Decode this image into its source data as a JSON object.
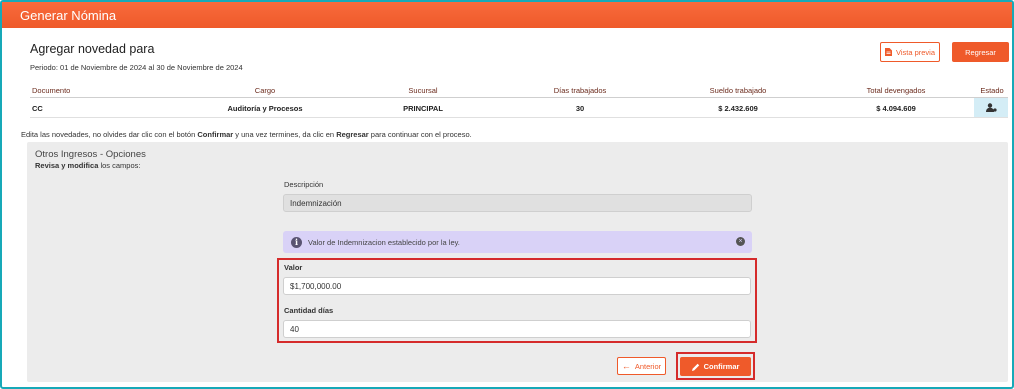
{
  "header": {
    "title": "Generar Nómina"
  },
  "page": {
    "title": "Agregar novedad para",
    "period": "Periodo: 01 de Noviembre de 2024 al 30 de Noviembre de 2024",
    "preview_label": "Vista previa",
    "back_label": "Regresar"
  },
  "table": {
    "headers": [
      "Documento",
      "Cargo",
      "Sucursal",
      "Días trabajados",
      "Sueldo trabajado",
      "Total devengados",
      "Estado"
    ],
    "row": [
      "CC",
      "Auditoría y Procesos",
      "PRINCIPAL",
      "30",
      "$ 2.432.609",
      "$ 4.094.609"
    ],
    "estado_icon": "user-settings-icon"
  },
  "instructions": {
    "part1": "Edita las novedades, no olvides dar clic con el botón ",
    "confirm": "Confirmar",
    "part2": " y una vez termines, da clic en ",
    "back": "Regresar",
    "part3": " para continuar con el proceso."
  },
  "panel": {
    "title": "Otros Ingresos - Opciones",
    "subtitle_bold": "Revisa y modifica",
    "subtitle_rest": " los campos:",
    "description_label": "Descripción",
    "description_value": "Indemnización",
    "alert_text": "Valor de Indemnizacion establecido por la ley.",
    "valor_label": "Valor",
    "valor_value": "$1,700,000.00",
    "dias_label": "Cantidad días",
    "dias_value": "40",
    "prev_label": "Anterior",
    "confirm_label": "Confirmar"
  },
  "colors": {
    "accent": "#ef5a2a",
    "frame": "#17a9b8",
    "highlight": "#d52b2b",
    "alert_bg": "#d9d2f7"
  }
}
